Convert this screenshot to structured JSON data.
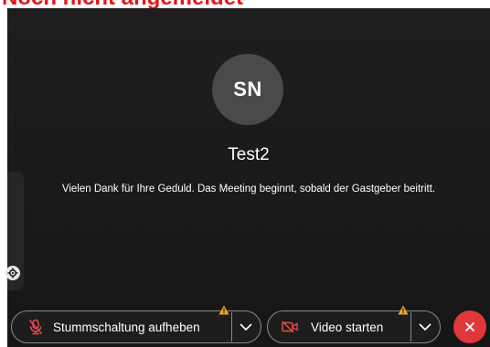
{
  "caption": {
    "text": "Noch nicht angemeldet"
  },
  "participant": {
    "initials": "SN",
    "name": "Test2"
  },
  "status": {
    "message": "Vielen Dank für Ihre Geduld. Das Meeting beginnt, sobald der Gastgeber beitritt."
  },
  "controls": {
    "mute_label": "Stummschaltung aufheben",
    "video_label": "Video starten"
  },
  "colors": {
    "caption": "#e8151b",
    "background": "#191919",
    "avatar": "#4a4a4a",
    "end_call": "#e0373d",
    "warning": "#f5a623",
    "muted_icon": "#e84b4b"
  },
  "icons": {
    "mute": "microphone-off-icon",
    "video": "video-off-icon",
    "warning": "warning-icon",
    "chevron": "chevron-down-icon",
    "end": "close-icon",
    "settings": "gear-icon"
  }
}
